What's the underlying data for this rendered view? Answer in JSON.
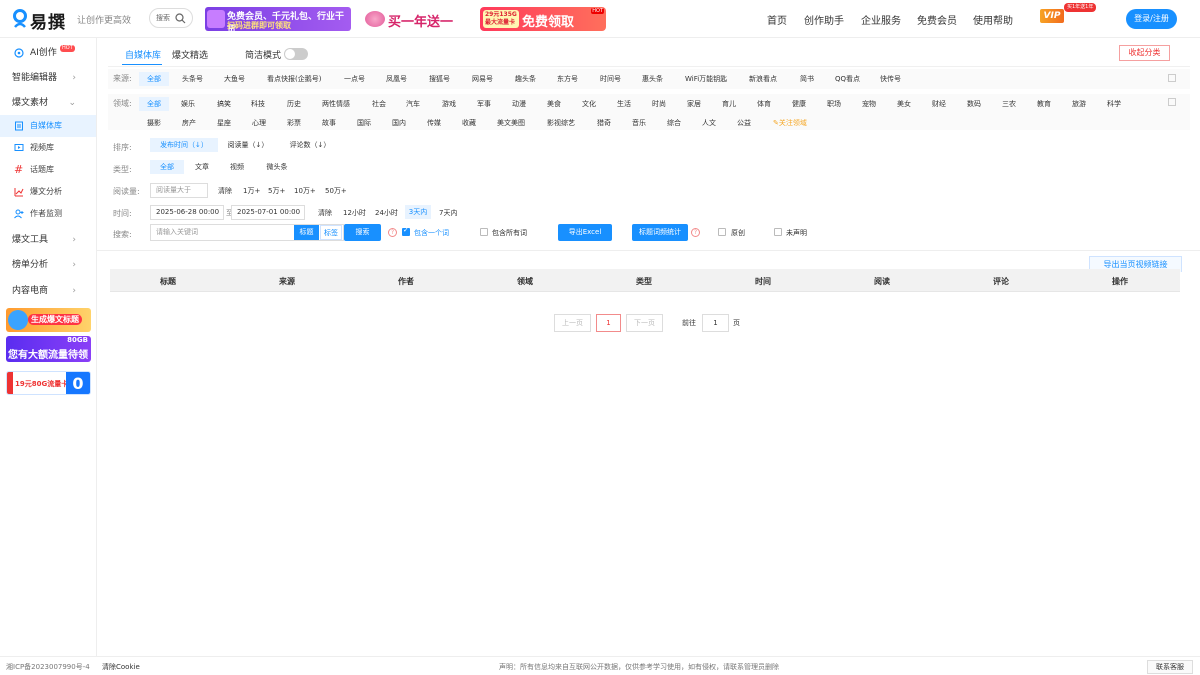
{
  "header": {
    "logo": "易撰",
    "slogan": "让创作更高效",
    "search_label": "搜索",
    "banner1": {
      "line1": "免费会员、千元礼包、行业干货",
      "line2": "扫码进群即可领取"
    },
    "banner2": "买一年送一年",
    "banner3": {
      "tag": "29元135G最大流量卡",
      "text": "免费领取",
      "hot": "HOT"
    },
    "nav": [
      "首页",
      "创作助手",
      "企业服务",
      "免费会员",
      "使用帮助"
    ],
    "vip": "VIP",
    "vip_tag": "买1年送1年",
    "login": "登录/注册"
  },
  "sidebar": {
    "ai": "AI创作",
    "ai_badge": "HOT",
    "smart_editor": "智能编辑器",
    "material": "爆文素材",
    "subs": [
      "自媒体库",
      "视频库",
      "话题库",
      "爆文分析",
      "作者监测"
    ],
    "tools": "爆文工具",
    "rank": "榜单分析",
    "ecom": "内容电商",
    "ad1": "生成爆文标题",
    "ad2_top": "80GB",
    "ad2": "您有大额流量待领取",
    "ad3": "19元80G流量卡",
    "ad3_big": "0"
  },
  "tabs": [
    "自媒体库",
    "爆文精选"
  ],
  "simple_mode": "简洁模式",
  "collapse": "收起分类",
  "filters": {
    "source_label": "来源:",
    "sources": [
      "全部",
      "头条号",
      "大鱼号",
      "看点快报(企鹅号)",
      "一点号",
      "凤凰号",
      "搜狐号",
      "网易号",
      "趣头条",
      "东方号",
      "时间号",
      "惠头条",
      "WiFi万能钥匙",
      "新浪看点",
      "简书",
      "QQ看点",
      "快传号"
    ],
    "field_label": "领域:",
    "fields1": [
      "全部",
      "娱乐",
      "搞笑",
      "科技",
      "历史",
      "两性情感",
      "社会",
      "汽车",
      "游戏",
      "军事",
      "动漫",
      "美食",
      "文化",
      "生活",
      "时尚",
      "家居",
      "育儿",
      "体育",
      "健康",
      "职场",
      "宠物",
      "美女",
      "财经",
      "数码",
      "三农",
      "教育",
      "旅游",
      "科学"
    ],
    "fields2": [
      "摄影",
      "房产",
      "星座",
      "心理",
      "彩票",
      "故事",
      "国际",
      "国内",
      "传媒",
      "收藏",
      "美文美图",
      "影视综艺",
      "猎奇",
      "音乐",
      "综合",
      "人文",
      "公益"
    ],
    "follow_field": "关注领域",
    "sort_label": "排序:",
    "sorts": [
      "发布时间（↓）",
      "阅读量（↓）",
      "评论数（↓）"
    ],
    "type_label": "类型:",
    "types": [
      "全部",
      "文章",
      "视频",
      "微头条"
    ],
    "read_label": "阅读量:",
    "read_placeholder": "阅读量大于",
    "read_opts": [
      "清除",
      "1万+",
      "5万+",
      "10万+",
      "50万+"
    ],
    "time_label": "时间:",
    "time_from": "2025-06-28 00:00",
    "time_to_sep": "至",
    "time_to": "2025-07-01 00:00",
    "time_opts": [
      "清除",
      "12小时",
      "24小时",
      "3天内",
      "7天内"
    ],
    "search_label": "搜索:",
    "search_placeholder": "请输入关键词",
    "search_modes": [
      "标题",
      "标签"
    ],
    "search_btn": "搜索",
    "include_one": "包含一个词",
    "include_all": "包含所有词",
    "export_excel": "导出Excel",
    "title_stat": "标题词频统计",
    "original": "原创",
    "undeclared": "未声明"
  },
  "export_video": "导出当页视频链接",
  "table": {
    "headers": [
      "标题",
      "来源",
      "作者",
      "领域",
      "类型",
      "时间",
      "阅读",
      "评论",
      "操作"
    ]
  },
  "pagination": {
    "prev": "上一页",
    "current": "1",
    "next": "下一页",
    "goto": "前往",
    "goto_val": "1",
    "page": "页"
  },
  "footer": {
    "icp": "湘ICP备2023007990号-4",
    "clear": "清除Cookie",
    "notice": "声明：所有信息均来自互联网公开数据，仅供参考学习使用，如有侵权，请联系管理员删除",
    "contact": "联系客服"
  },
  "colors": {
    "accent": "#1890ff",
    "danger": "#e33333"
  }
}
